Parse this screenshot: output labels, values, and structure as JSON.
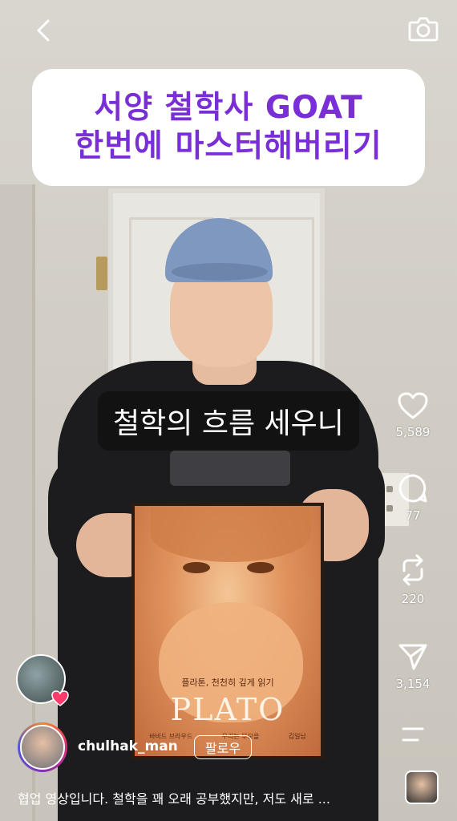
{
  "header": {
    "back_icon": "chevron-left-icon",
    "camera_icon": "camera-icon"
  },
  "overlay": {
    "title_line1": "서양 철학사 GOAT",
    "title_line2": "한번에 마스터해버리기",
    "caption": "철학의 흐름 세우니",
    "title_color": "#7a2fd6"
  },
  "book": {
    "subtitle": "플라톤, 천천히 깊게 읽기",
    "name": "PLATO",
    "footer_left": "바비드 브라우드",
    "footer_mid": "우리는 부모을",
    "footer_right": "김일남"
  },
  "actions": {
    "likes": "5,589",
    "comments": "77",
    "reposts": "220",
    "shares": "3,154"
  },
  "post": {
    "username": "chulhak_man",
    "follow_label": "팔로우",
    "description": "협업 영상입니다. 철학을 꽤 오래 공부했지만, 저도 새로 ..."
  }
}
